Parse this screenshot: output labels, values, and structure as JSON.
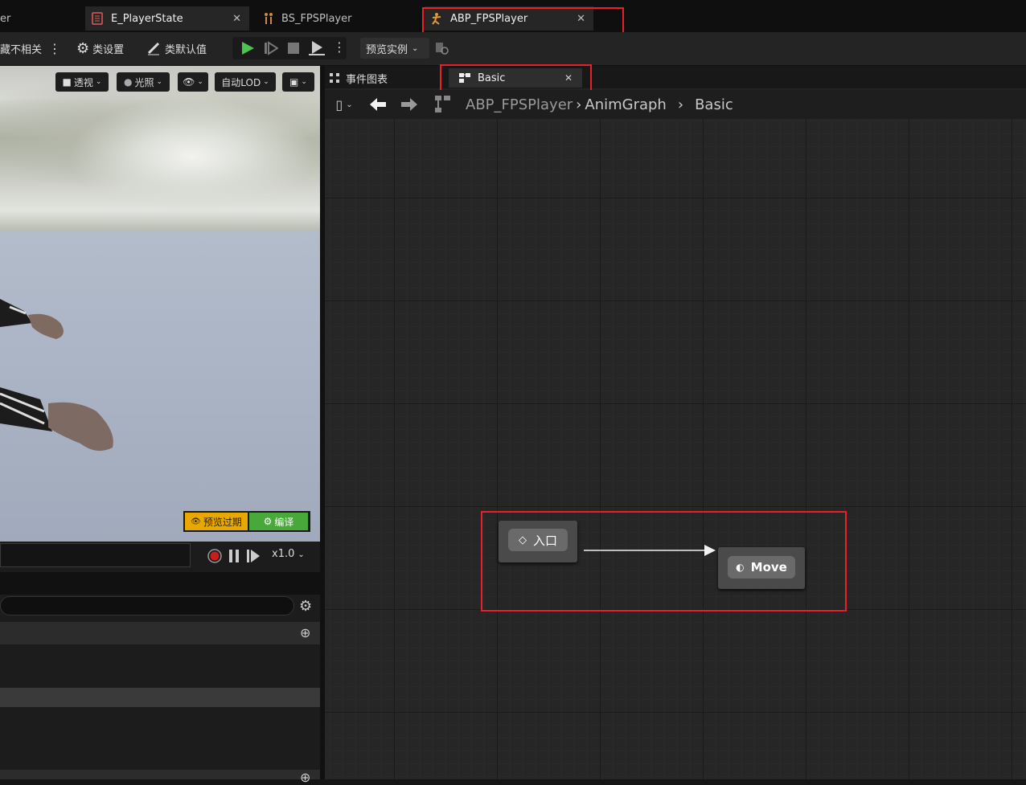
{
  "tabs": [
    {
      "label": "er",
      "active": false
    },
    {
      "label": "E_PlayerState",
      "active": true,
      "closable": true
    },
    {
      "label": "BS_FPSPlayer",
      "active": false
    },
    {
      "label": "ABP_FPSPlayer",
      "active": true,
      "closable": true
    }
  ],
  "toolbar": {
    "hide_unrelated": "藏不相关",
    "class_settings": "类设置",
    "class_defaults": "类默认值",
    "preview_instance": "预览实例"
  },
  "viewport": {
    "perspective": "透视",
    "lighting": "光照",
    "auto_lod": "自动LOD",
    "preview_outdated": "预览过期",
    "compile": "编译",
    "speed": "x1.0"
  },
  "graph": {
    "event_graph_tab": "事件图表",
    "basic_tab": "Basic",
    "breadcrumb": [
      "ABP_FPSPlayer",
      "AnimGraph",
      "Basic"
    ],
    "entry_node": "入口",
    "state_node": "Move"
  },
  "colors": {
    "highlight": "#e8202a",
    "play": "#4cc34c",
    "warning": "#e8a800",
    "compile_ok": "#49a83a"
  }
}
